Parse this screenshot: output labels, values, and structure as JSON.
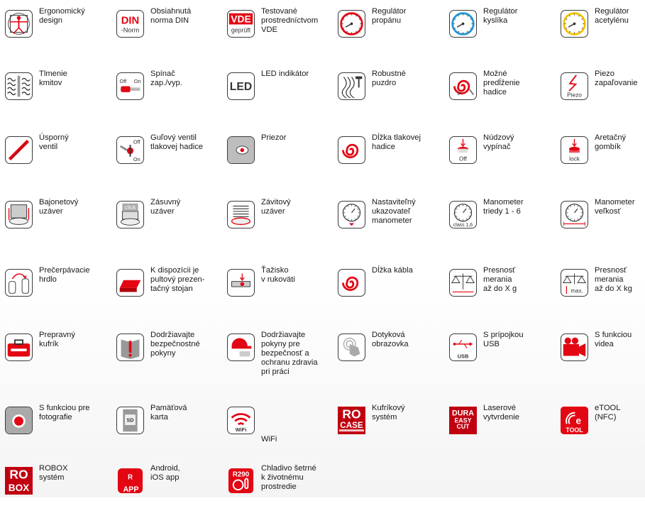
{
  "colors": {
    "accent": "#e30613",
    "dark": "#333333",
    "blue": "#1f97d4",
    "yellow": "#f2c200"
  },
  "items": [
    {
      "label": "Ergonomický\ndesign",
      "icon": "vitruvian-man-icon"
    },
    {
      "label": "Obsiahnutá\nnorma DIN",
      "icon": "din-norm-icon",
      "icon_text": [
        "DIN",
        "-Norm"
      ]
    },
    {
      "label": "Testované\nprostredníctvom\nVDE",
      "icon": "vde-tested-icon",
      "icon_text": [
        "VDE",
        "geprüft"
      ]
    },
    {
      "label": "Regulátor\npropánu",
      "icon": "propane-regulator-icon"
    },
    {
      "label": "Regulátor\nkyslíka",
      "icon": "oxygen-regulator-icon"
    },
    {
      "label": "Regulátor\nacetylénu",
      "icon": "acetylene-regulator-icon"
    },
    {
      "label": "Tlmenie\nkmitov",
      "icon": "vibration-damping-icon"
    },
    {
      "label": "Spínač\nzap./vyp.",
      "icon": "on-off-switch-icon",
      "icon_text": [
        "Off",
        "On"
      ]
    },
    {
      "label": "LED indikátor",
      "icon": "led-indicator-icon",
      "icon_text": [
        "LED"
      ]
    },
    {
      "label": "Robustné\npuzdro",
      "icon": "robust-housing-icon"
    },
    {
      "label": "Možné\npredĺženie\nhadice",
      "icon": "hose-extension-icon"
    },
    {
      "label": "Piezo\nzapaľovanie",
      "icon": "piezo-ignition-icon",
      "icon_text": [
        "Piezo"
      ]
    },
    {
      "label": "Úsporný\nventil",
      "icon": "economy-valve-icon"
    },
    {
      "label": "Guľový ventil\ntlakovej hadice",
      "icon": "ball-valve-icon",
      "icon_text": [
        "Off",
        "On"
      ]
    },
    {
      "label": "Priezor",
      "icon": "sight-glass-icon"
    },
    {
      "label": "Dĺžka tlakovej\nhadice",
      "icon": "pressure-hose-length-icon"
    },
    {
      "label": "Núdzový\nvypínač",
      "icon": "emergency-stop-icon",
      "icon_text": [
        "Off"
      ]
    },
    {
      "label": "Aretačný\ngombík",
      "icon": "locking-button-icon",
      "icon_text": [
        "lock"
      ]
    },
    {
      "label": "Bajonetový\nuzáver",
      "icon": "bayonet-closure-icon"
    },
    {
      "label": "Zásuvný\nuzáver",
      "icon": "plug-closure-icon",
      "icon_text": [
        "click"
      ]
    },
    {
      "label": "Závitový\nuzáver",
      "icon": "threaded-closure-icon"
    },
    {
      "label": "Nastaviteľný\nukazovateľ\nmanometer",
      "icon": "adjustable-manometer-icon"
    },
    {
      "label": "Manometer\ntriedy 1 - 6",
      "icon": "manometer-class-icon",
      "icon_text": [
        "class 1,6"
      ]
    },
    {
      "label": "Manometer\nveľkosť",
      "icon": "manometer-size-icon"
    },
    {
      "label": "Prečerpávacie\nhrdlo",
      "icon": "transfer-neck-icon"
    },
    {
      "label": "K dispozícii je\npultový prezen-\ntačný stojan",
      "icon": "display-stand-icon"
    },
    {
      "label": "Ťažisko\nv rukoväti",
      "icon": "handle-center-of-gravity-icon"
    },
    {
      "label": "Dĺžka kábla",
      "icon": "cable-length-icon"
    },
    {
      "label": "Presnosť\nmerania\naž do X g",
      "icon": "scale-grams-icon"
    },
    {
      "label": "Presnosť\nmerania\naž do X kg",
      "icon": "scale-kg-icon",
      "icon_text": [
        "max."
      ]
    },
    {
      "label": "Prepravný\nkufrík",
      "icon": "carrying-case-icon"
    },
    {
      "label": "Dodržiavajte\nbezpečnostné\npokyny",
      "icon": "safety-manual-icon"
    },
    {
      "label": "Dodržiavajte\npokyny pre\nbezpečnosť a\nochranu zdravia\npri práci",
      "icon": "health-safety-icon"
    },
    {
      "label": "Dotyková\nobrazovka",
      "icon": "touchscreen-icon"
    },
    {
      "label": "S prípojkou\nUSB",
      "icon": "usb-port-icon",
      "icon_text": [
        "USB"
      ]
    },
    {
      "label": "S funkciou\nvidea",
      "icon": "video-camera-icon"
    },
    {
      "label": "S funkciou pre\nfotografie",
      "icon": "photo-camera-icon"
    },
    {
      "label": "Pamäťová\nkarta",
      "icon": "memory-card-icon",
      "icon_text": [
        "SD"
      ]
    },
    {
      "label": "WiFi",
      "icon": "wifi-icon",
      "icon_text": [
        "WiFi"
      ]
    },
    {
      "label": "Kufríkový\nsystém",
      "icon": "rocase-logo-icon",
      "icon_text": [
        "RO",
        "CASE"
      ]
    },
    {
      "label": "Laserové\nvytvrdenie",
      "icon": "dura-easy-cut-icon",
      "icon_text": [
        "DURA",
        "EASY",
        "CUT"
      ]
    },
    {
      "label": "eTOOL\n(NFC)",
      "icon": "etool-nfc-icon",
      "icon_text": [
        "TOOL"
      ]
    },
    {
      "label": "ROBOX\nsystém",
      "icon": "robox-logo-icon",
      "icon_text": [
        "RO",
        "BOX"
      ]
    },
    {
      "label": "Android,\niOS app",
      "icon": "app-icon",
      "icon_text": [
        "R",
        "APP"
      ]
    },
    {
      "label": "Chladivo šetrné\nk životnému\nprostredie",
      "icon": "r290-refrigerant-icon",
      "icon_text": [
        "R290"
      ]
    }
  ]
}
